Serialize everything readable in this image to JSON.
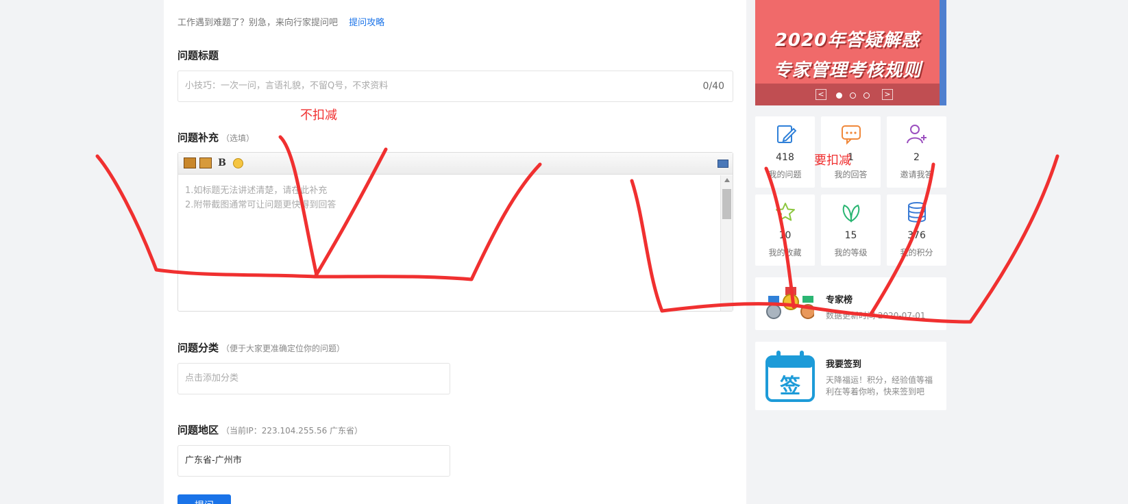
{
  "form": {
    "intro_text": "工作遇到难题了？别急，来向行家提问吧",
    "intro_link": "提问攻略",
    "title_label": "问题标题",
    "title_placeholder": "小技巧：一次一问，言语礼貌，不留Q号，不求资料",
    "title_counter": "0/40",
    "supplement_label": "问题补充",
    "supplement_hint": "（选填）",
    "editor_lines": [
      "1.如标题无法讲述清楚，请在此补充",
      "2.附带截图通常可让问题更快得到回答"
    ],
    "category_label": "问题分类",
    "category_hint": "（便于大家更准确定位你的问题）",
    "category_placeholder": "点击添加分类",
    "region_label": "问题地区",
    "region_hint": "（当前IP：223.104.255.56 广东省）",
    "region_value": "广东省-广州市",
    "submit_label": "提问"
  },
  "toolbar": {
    "bold_label": "B"
  },
  "banner": {
    "line1": "2020年答疑解惑",
    "line2": "专家管理考核规则",
    "prev": "<",
    "next": ">",
    "active_slide": 1,
    "slide_count": 3
  },
  "stats": [
    {
      "icon": "edit-icon",
      "value": "418",
      "label": "我的问题",
      "color": "#2f80d8"
    },
    {
      "icon": "chat-icon",
      "value": "1",
      "label": "我的回答",
      "color": "#f0883a"
    },
    {
      "icon": "invite-user-icon",
      "value": "2",
      "label": "邀请我答",
      "color": "#9b4fbf"
    },
    {
      "icon": "star-icon",
      "value": "10",
      "label": "我的收藏",
      "color": "#8cc63f"
    },
    {
      "icon": "leaf-icon",
      "value": "15",
      "label": "我的等级",
      "color": "#2bb673"
    },
    {
      "icon": "coins-icon",
      "value": "376",
      "label": "我的积分",
      "color": "#3a7bd5"
    }
  ],
  "expert_card": {
    "title": "专家榜",
    "sub": "数据更新时间 2020-07-01"
  },
  "signin_card": {
    "title": "我要签到",
    "sub_line1": "天降福运！积分，经验值等福",
    "sub_line2": "利在等着你哟，快来签到吧",
    "calendar_char": "签"
  },
  "annotations": {
    "left_note": "不扣减",
    "right_note": "要扣减",
    "ink_color": "#f03030"
  }
}
